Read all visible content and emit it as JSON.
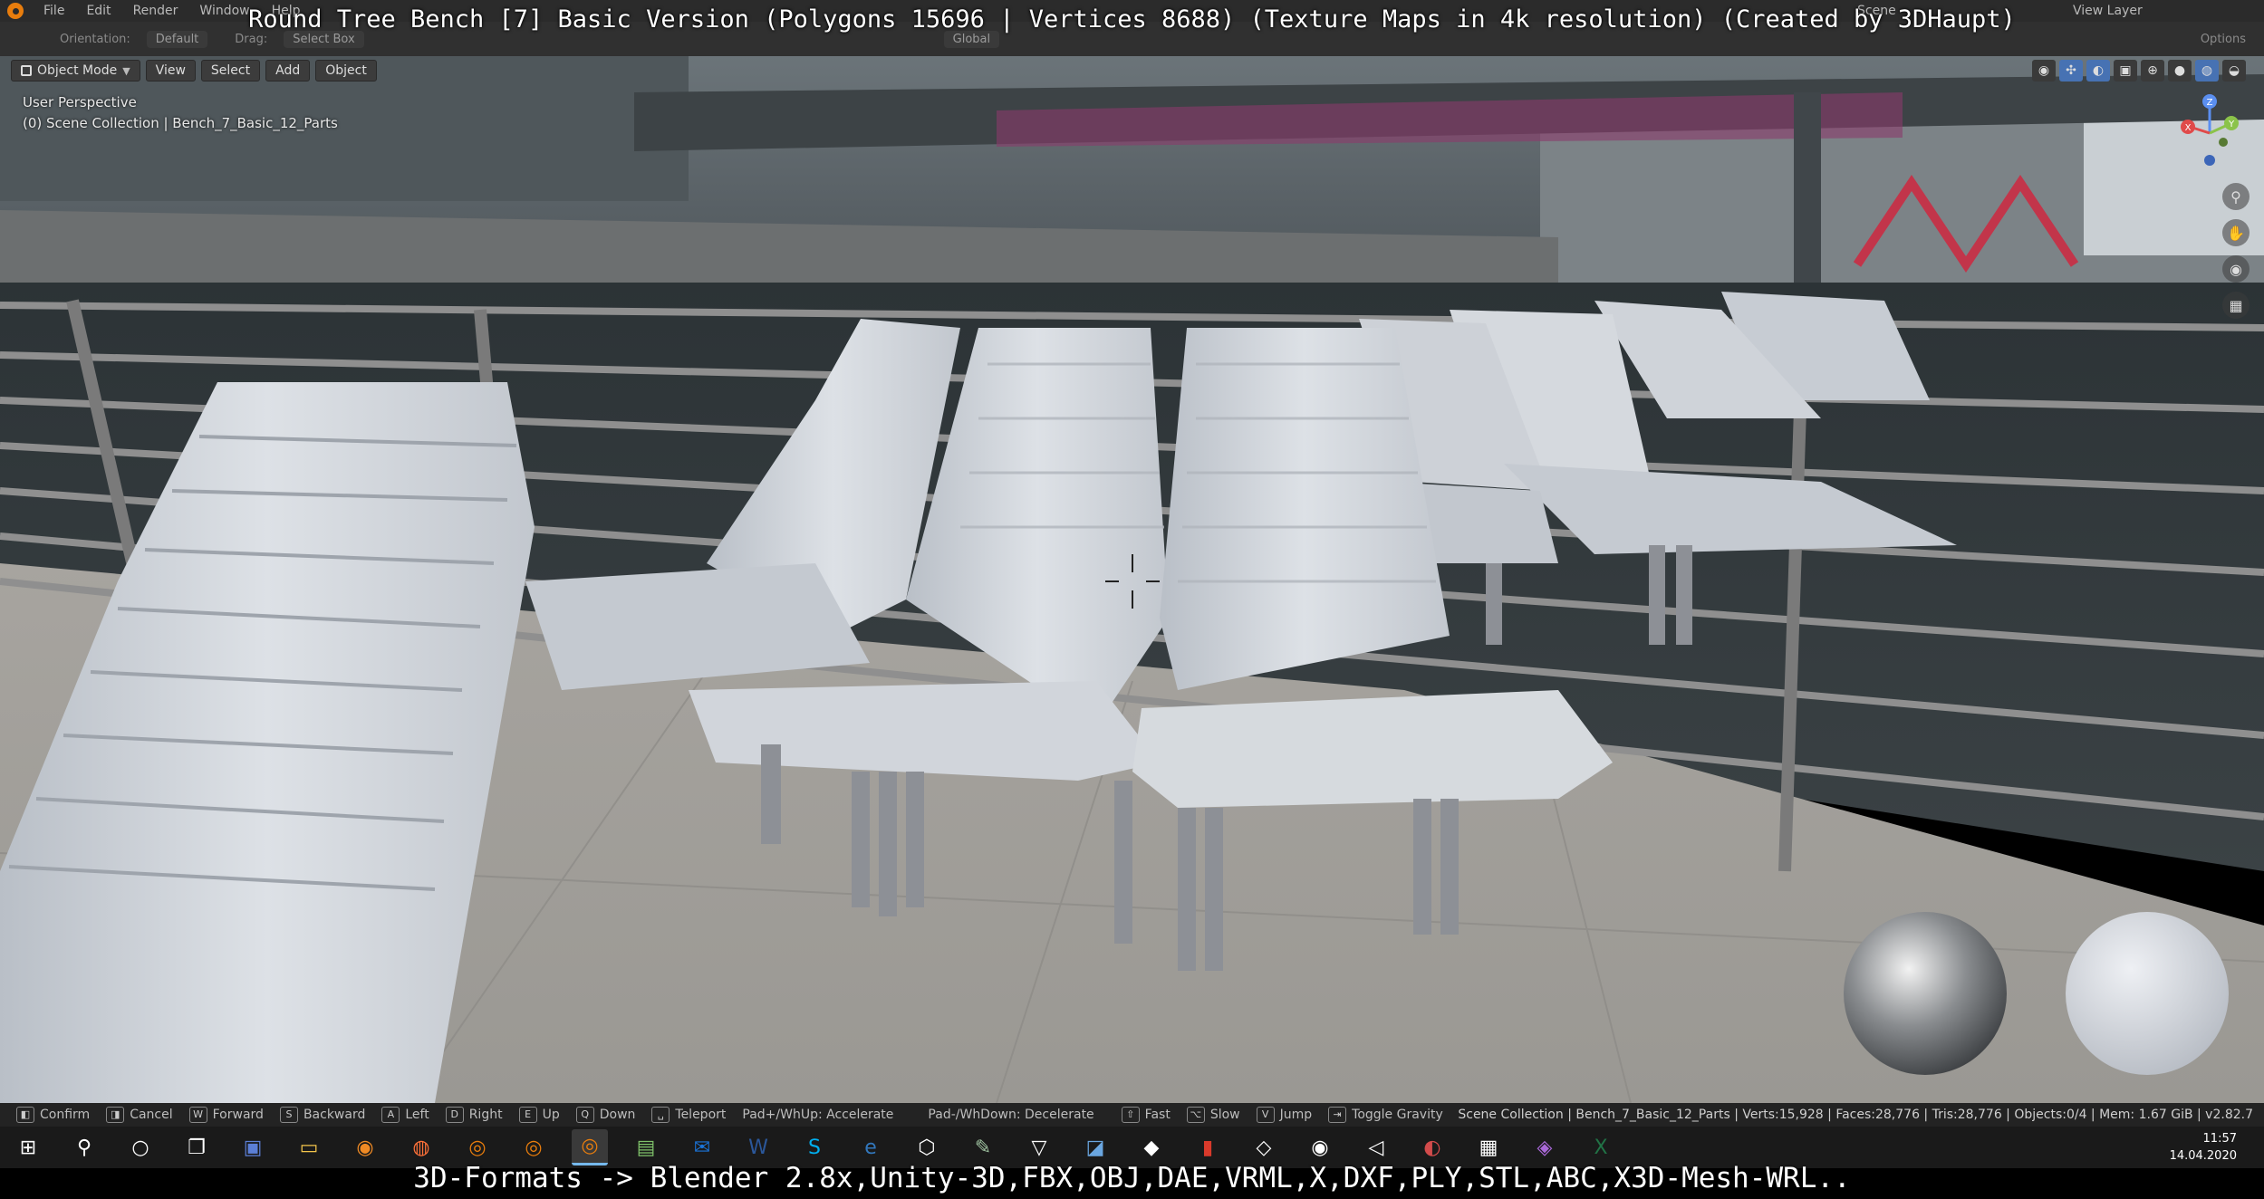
{
  "video_title": "Round Tree Bench [7] Basic Version (Polygons 15696 | Vertices 8688) (Texture Maps in 4k resolution) (Created by 3DHaupt)",
  "bottom_caption": "3D-Formats -> Blender 2.8x,Unity-3D,FBX,OBJ,DAE,VRML,X,DXF,PLY,STL,ABC,X3D-Mesh-WRL..",
  "menubar": {
    "items": [
      "File",
      "Edit",
      "Render",
      "Window",
      "Help"
    ],
    "right": {
      "scene_label": "Scene",
      "view_layer_label": "View Layer"
    }
  },
  "tool_header": {
    "orientation_label": "Orientation:",
    "orientation_value": "Default",
    "drag_label": "Drag:",
    "drag_value": "Select Box",
    "transform_value": "Global",
    "options_label": "Options"
  },
  "viewport_header": {
    "mode": "Object Mode",
    "menus": [
      "View",
      "Select",
      "Add",
      "Object"
    ]
  },
  "viewport_overlay": {
    "perspective": "User Perspective",
    "collection": "(0) Scene Collection | Bench_7_Basic_12_Parts"
  },
  "gizmo": {
    "z": "Z",
    "y": "Y",
    "x": "X"
  },
  "status_bar": {
    "items": [
      {
        "key": "",
        "label": "Confirm"
      },
      {
        "key": "",
        "label": "Cancel"
      },
      {
        "key": "W",
        "label": "Forward"
      },
      {
        "key": "S",
        "label": "Backward"
      },
      {
        "key": "A",
        "label": "Left"
      },
      {
        "key": "D",
        "label": "Right"
      },
      {
        "key": "E",
        "label": "Up"
      },
      {
        "key": "Q",
        "label": "Down"
      },
      {
        "key": "",
        "label": "Teleport"
      },
      {
        "key": "",
        "label": "Pad+/WhUp: Accelerate"
      },
      {
        "key": "",
        "label": "Pad-/WhDown: Decelerate"
      },
      {
        "key": "",
        "label": "Fast"
      },
      {
        "key": "",
        "label": "Slow"
      },
      {
        "key": "V",
        "label": "Jump"
      },
      {
        "key": "",
        "label": "Toggle Gravity"
      }
    ],
    "scene_info": "Scene Collection | Bench_7_Basic_12_Parts | Verts:15,928 | Faces:28,776 | Tris:28,776 | Objects:0/4 | Mem: 1.67 GiB | v2.82.7"
  },
  "taskbar": {
    "time": "11:57",
    "date": "14.04.2020"
  },
  "colors": {
    "accent": "#4772b3",
    "bench": "#c9ced6",
    "railing": "#8f8f8f"
  }
}
